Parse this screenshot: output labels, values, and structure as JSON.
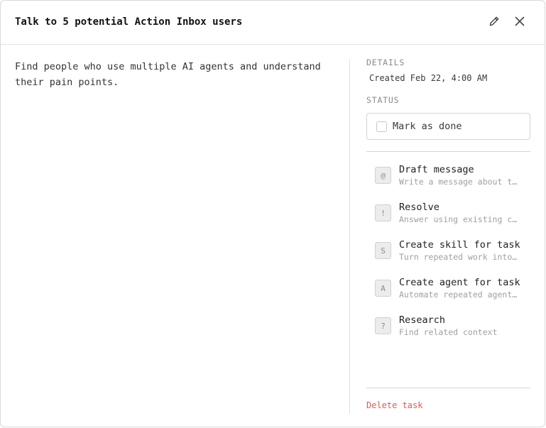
{
  "header": {
    "title": "Talk to 5 potential Action Inbox users"
  },
  "icons": {
    "edit": "pencil-icon",
    "close": "close-icon"
  },
  "description": "Find people who use multiple AI agents and understand their pain points.",
  "details": {
    "label": "DETAILS",
    "created": "Created Feb 22, 4:00 AM"
  },
  "status": {
    "label": "STATUS",
    "done_label": "Mark as done",
    "checked": false
  },
  "actions": [
    {
      "badge": "@",
      "title": "Draft message",
      "subtitle": "Write a message about t…"
    },
    {
      "badge": "!",
      "title": "Resolve",
      "subtitle": "Answer using existing c…"
    },
    {
      "badge": "S",
      "title": "Create skill for task",
      "subtitle": "Turn repeated work into…"
    },
    {
      "badge": "A",
      "title": "Create agent for task",
      "subtitle": "Automate repeated agent…"
    },
    {
      "badge": "?",
      "title": "Research",
      "subtitle": "Find related context"
    }
  ],
  "delete_label": "Delete task",
  "colors": {
    "danger": "#e05a5a",
    "muted": "#8a8a8a",
    "border": "#d4d4d4"
  }
}
